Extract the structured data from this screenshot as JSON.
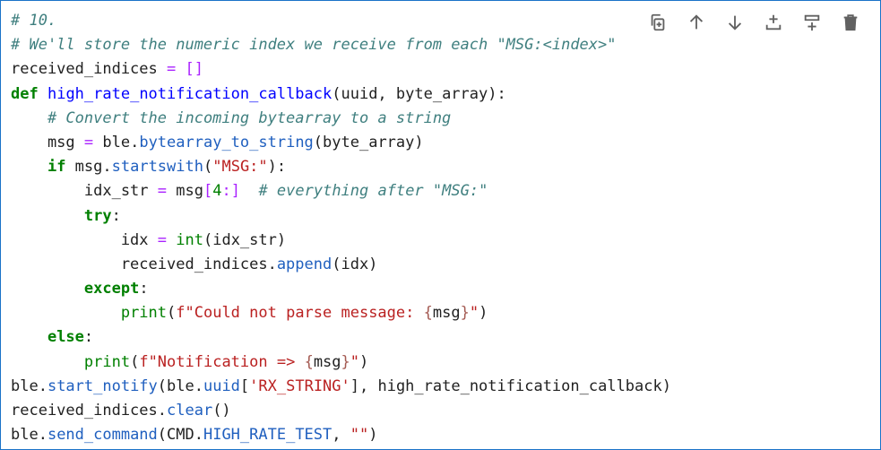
{
  "cell": {
    "lines": [
      [
        {
          "t": "# 10.",
          "c": "comment"
        }
      ],
      [
        {
          "t": "# We'll store the numeric index we receive from each \"MSG:<index>\"",
          "c": "comment"
        }
      ],
      [
        {
          "t": "received_indices",
          "c": "var"
        },
        {
          "t": " ",
          "c": "var"
        },
        {
          "t": "=",
          "c": "op"
        },
        {
          "t": " ",
          "c": "var"
        },
        {
          "t": "[]",
          "c": "op"
        }
      ],
      [
        {
          "t": "def",
          "c": "keyword"
        },
        {
          "t": " ",
          "c": "var"
        },
        {
          "t": "high_rate_notification_callback",
          "c": "def"
        },
        {
          "t": "(uuid, byte_array):",
          "c": "var"
        }
      ],
      [
        {
          "t": "    ",
          "c": "var"
        },
        {
          "t": "# Convert the incoming bytearray to a string",
          "c": "comment"
        }
      ],
      [
        {
          "t": "    msg ",
          "c": "var"
        },
        {
          "t": "=",
          "c": "op"
        },
        {
          "t": " ble.",
          "c": "var"
        },
        {
          "t": "bytearray_to_string",
          "c": "attr"
        },
        {
          "t": "(byte_array)",
          "c": "var"
        }
      ],
      [
        {
          "t": "    ",
          "c": "var"
        },
        {
          "t": "if",
          "c": "keyword"
        },
        {
          "t": " msg.",
          "c": "var"
        },
        {
          "t": "startswith",
          "c": "attr"
        },
        {
          "t": "(",
          "c": "var"
        },
        {
          "t": "\"MSG:\"",
          "c": "string"
        },
        {
          "t": "):",
          "c": "var"
        }
      ],
      [
        {
          "t": "        idx_str ",
          "c": "var"
        },
        {
          "t": "=",
          "c": "op"
        },
        {
          "t": " msg",
          "c": "var"
        },
        {
          "t": "[",
          "c": "op"
        },
        {
          "t": "4",
          "c": "number"
        },
        {
          "t": ":]",
          "c": "op"
        },
        {
          "t": "  ",
          "c": "var"
        },
        {
          "t": "# everything after \"MSG:\"",
          "c": "comment"
        }
      ],
      [
        {
          "t": "        ",
          "c": "var"
        },
        {
          "t": "try",
          "c": "keyword"
        },
        {
          "t": ":",
          "c": "var"
        }
      ],
      [
        {
          "t": "            idx ",
          "c": "var"
        },
        {
          "t": "=",
          "c": "op"
        },
        {
          "t": " ",
          "c": "var"
        },
        {
          "t": "int",
          "c": "builtin"
        },
        {
          "t": "(idx_str)",
          "c": "var"
        }
      ],
      [
        {
          "t": "            received_indices.",
          "c": "var"
        },
        {
          "t": "append",
          "c": "attr"
        },
        {
          "t": "(idx)",
          "c": "var"
        }
      ],
      [
        {
          "t": "        ",
          "c": "var"
        },
        {
          "t": "except",
          "c": "keyword"
        },
        {
          "t": ":",
          "c": "var"
        }
      ],
      [
        {
          "t": "            ",
          "c": "var"
        },
        {
          "t": "print",
          "c": "builtin"
        },
        {
          "t": "(",
          "c": "var"
        },
        {
          "t": "f\"Could not parse message: ",
          "c": "fstr"
        },
        {
          "t": "{",
          "c": "interp"
        },
        {
          "t": "msg",
          "c": "var"
        },
        {
          "t": "}",
          "c": "interp"
        },
        {
          "t": "\"",
          "c": "fstr"
        },
        {
          "t": ")",
          "c": "var"
        }
      ],
      [
        {
          "t": "    ",
          "c": "var"
        },
        {
          "t": "else",
          "c": "keyword"
        },
        {
          "t": ":",
          "c": "var"
        }
      ],
      [
        {
          "t": "        ",
          "c": "var"
        },
        {
          "t": "print",
          "c": "builtin"
        },
        {
          "t": "(",
          "c": "var"
        },
        {
          "t": "f\"Notification => ",
          "c": "fstr"
        },
        {
          "t": "{",
          "c": "interp"
        },
        {
          "t": "msg",
          "c": "var"
        },
        {
          "t": "}",
          "c": "interp"
        },
        {
          "t": "\"",
          "c": "fstr"
        },
        {
          "t": ")",
          "c": "var"
        }
      ],
      [
        {
          "t": "ble.",
          "c": "var"
        },
        {
          "t": "start_notify",
          "c": "attr"
        },
        {
          "t": "(ble.",
          "c": "var"
        },
        {
          "t": "uuid",
          "c": "attr"
        },
        {
          "t": "[",
          "c": "var"
        },
        {
          "t": "'RX_STRING'",
          "c": "string"
        },
        {
          "t": "], high_rate_notification_callback)",
          "c": "var"
        }
      ],
      [
        {
          "t": "received_indices.",
          "c": "var"
        },
        {
          "t": "clear",
          "c": "attr"
        },
        {
          "t": "()",
          "c": "var"
        }
      ],
      [
        {
          "t": "ble.",
          "c": "var"
        },
        {
          "t": "send_command",
          "c": "attr"
        },
        {
          "t": "(CMD.",
          "c": "var"
        },
        {
          "t": "HIGH_RATE_TEST",
          "c": "attr"
        },
        {
          "t": ", ",
          "c": "var"
        },
        {
          "t": "\"\"",
          "c": "string"
        },
        {
          "t": ")",
          "c": "var"
        }
      ]
    ]
  },
  "toolbar": {
    "buttons": [
      {
        "name": "duplicate-cell-button",
        "icon": "copy-icon"
      },
      {
        "name": "move-cell-up-button",
        "icon": "arrow-up-icon"
      },
      {
        "name": "move-cell-down-button",
        "icon": "arrow-down-icon"
      },
      {
        "name": "insert-cell-above-button",
        "icon": "insert-above-icon"
      },
      {
        "name": "insert-cell-below-button",
        "icon": "insert-below-icon"
      },
      {
        "name": "delete-cell-button",
        "icon": "trash-icon"
      }
    ]
  },
  "colors": {
    "cell_border": "#1a73c8",
    "comment": "#3f7f7f",
    "keyword": "#008000",
    "string": "#ba2121",
    "attribute": "#1f5fbf",
    "icon": "#616161"
  }
}
